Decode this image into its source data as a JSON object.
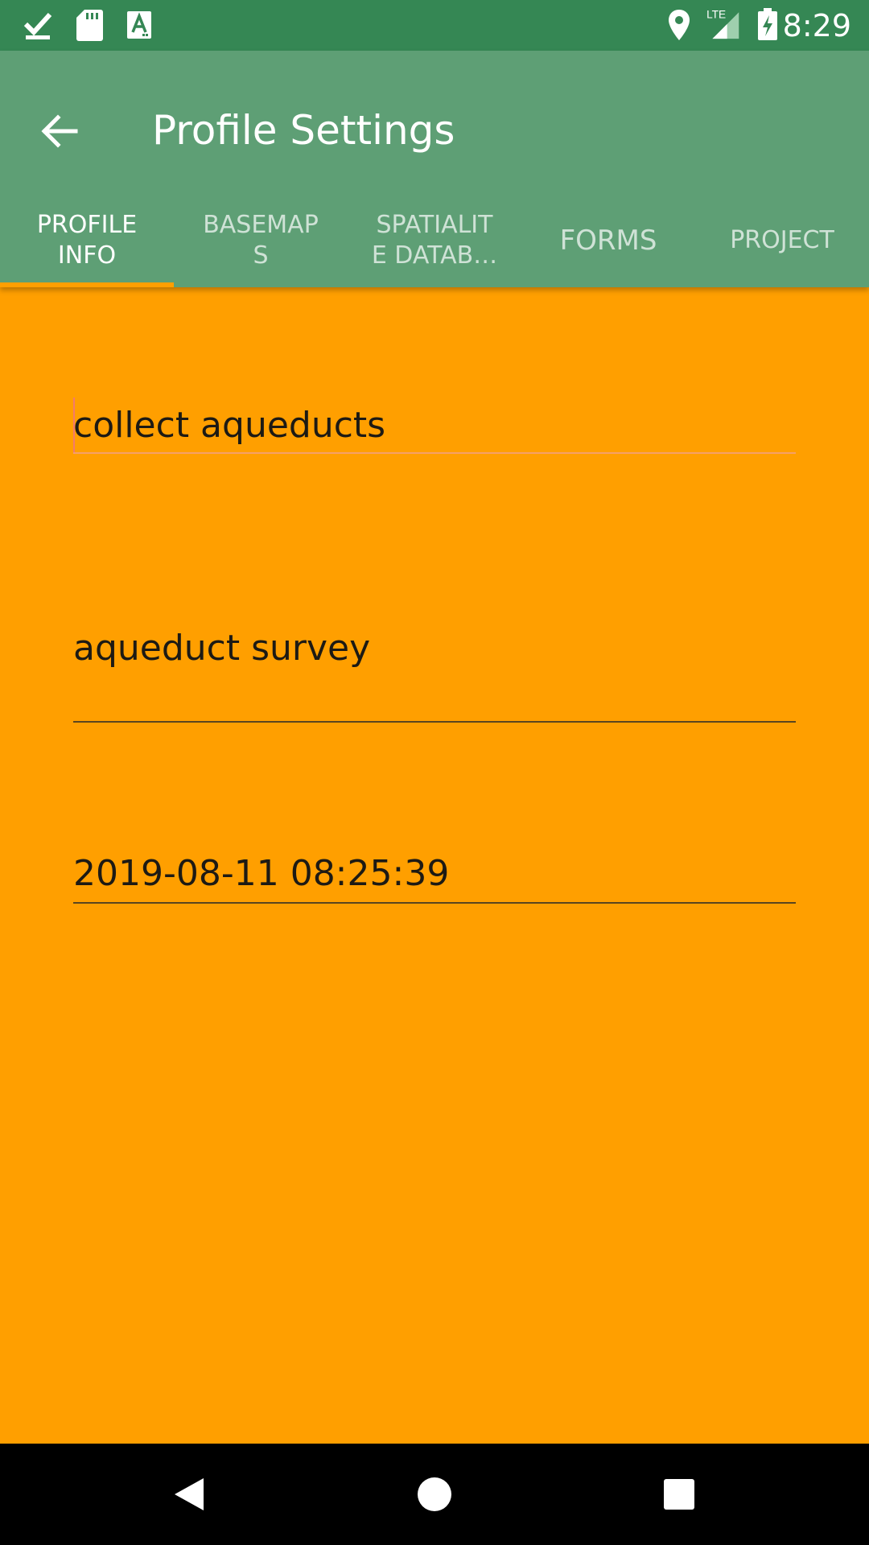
{
  "status_bar": {
    "time": "8:29",
    "network_label": "LTE",
    "icons": [
      "download-done-icon",
      "sd-card-icon",
      "text-a-icon",
      "location-pin-icon",
      "lte-signal-icon",
      "battery-charging-icon"
    ]
  },
  "app_bar": {
    "title": "Profile Settings",
    "back_icon": "arrow-back-icon"
  },
  "tabs": [
    {
      "line1": "PROFILE",
      "line2": "INFO",
      "active": true
    },
    {
      "line1": "BASEMAP",
      "line2": "S",
      "active": false
    },
    {
      "line1": "SPATIALIT",
      "line2": "E DATAB…",
      "active": false
    },
    {
      "line1": "FORMS",
      "line2": "",
      "active": false
    },
    {
      "line1": "PROJECT",
      "line2": "",
      "active": false
    }
  ],
  "fields": {
    "name": "collect aqueducts",
    "description": "aqueduct survey",
    "date": "2019-08-11 08:25:39"
  },
  "colors": {
    "status_bar": "#358754",
    "app_bar": "#5e9f75",
    "background": "#ff9f00",
    "tab_indicator": "#ff9f00"
  },
  "nav_bar": {
    "buttons": [
      "back-triangle-icon",
      "home-circle-icon",
      "recents-square-icon"
    ]
  }
}
